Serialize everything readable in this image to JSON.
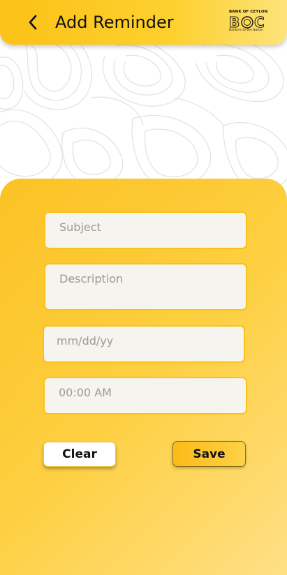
{
  "header": {
    "title": "Add Reminder",
    "back_icon": "chevron-left-icon"
  },
  "logo": {
    "bank_name": "BANK OF CEYLON",
    "mark": "BOC",
    "tagline": "Bankers to the Nation"
  },
  "form": {
    "subject": {
      "value": "",
      "placeholder": "Subject"
    },
    "description": {
      "value": "",
      "placeholder": "Description"
    },
    "date": {
      "value": "",
      "placeholder": "mm/dd/yy"
    },
    "time": {
      "value": "",
      "placeholder": "00:00 AM"
    }
  },
  "buttons": {
    "clear_label": "Clear",
    "save_label": "Save"
  },
  "colors": {
    "accent": "#fcc217",
    "field_border": "#fbc117",
    "field_bg": "#f6f4ef"
  }
}
